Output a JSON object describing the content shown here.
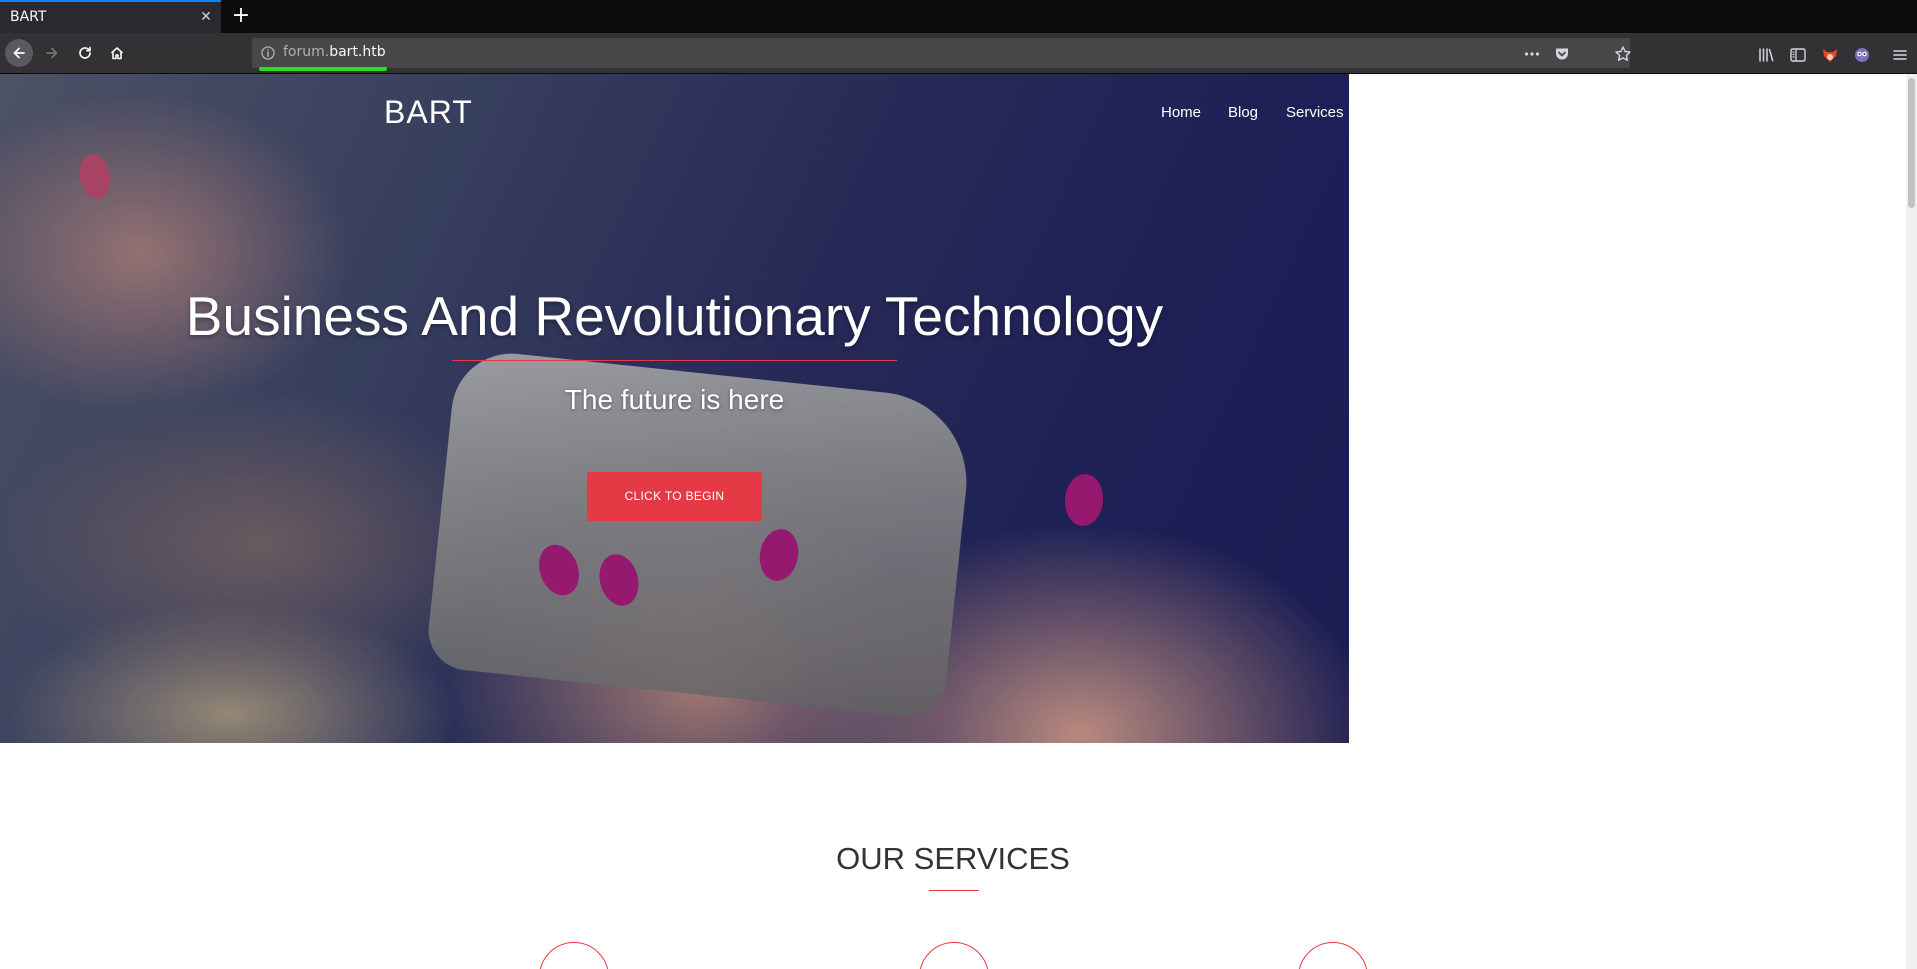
{
  "browser": {
    "tab_title": "BART",
    "url_subdomain": "forum.",
    "url_domain": "bart.htb",
    "icons": {
      "back": "back-arrow-icon",
      "forward": "forward-arrow-icon",
      "reload": "reload-icon",
      "home": "home-icon",
      "page_info": "info-icon",
      "page_actions": "more-icon",
      "pocket": "pocket-icon",
      "bookmark": "star-icon",
      "library": "library-icon",
      "sidebar": "sidebar-icon",
      "extension_1": "fox-extension-icon",
      "extension_2": "owl-extension-icon",
      "menu": "hamburger-menu-icon"
    },
    "accent_color": "#0a84ff",
    "loading_color": "#2bdd21"
  },
  "site": {
    "brand": "BART",
    "nav": [
      "Home",
      "Blog",
      "Services"
    ],
    "hero": {
      "headline": "Business And Revolutionary Technology",
      "tagline": "The future is here",
      "cta_label": "CLICK TO BEGIN",
      "accent_color": "#e63946"
    },
    "services": {
      "title": "OUR SERVICES"
    }
  }
}
